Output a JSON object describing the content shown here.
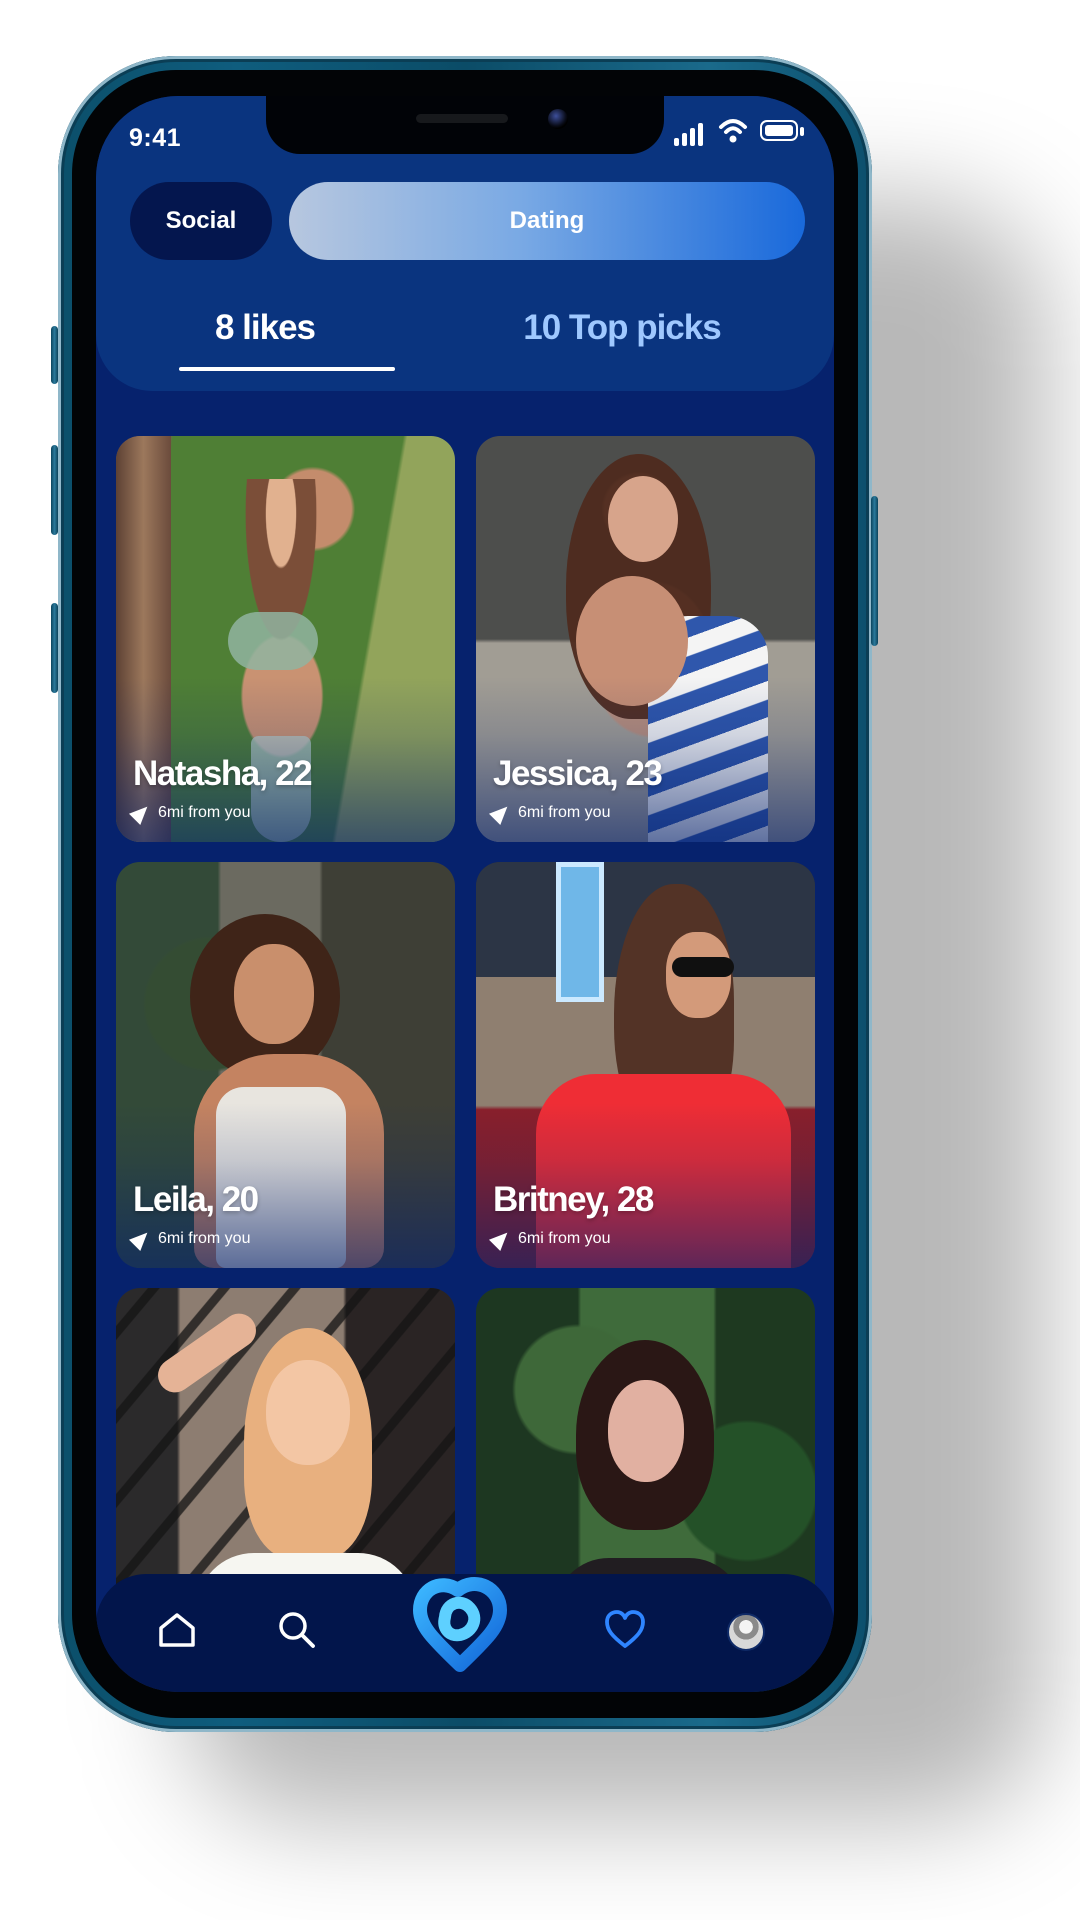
{
  "status_bar": {
    "time": "9:41",
    "icons": [
      "signal-icon",
      "wifi-icon",
      "battery-icon"
    ]
  },
  "mode_tabs": [
    {
      "label": "Social",
      "selected": false
    },
    {
      "label": "Dating",
      "selected": true
    }
  ],
  "subtabs": {
    "likes": "8 likes",
    "top_picks": "10 Top picks",
    "selected": "8 likes"
  },
  "profiles": [
    {
      "name": "Natasha, 22",
      "distance": "6mi from you"
    },
    {
      "name": "Jessica, 23",
      "distance": "6mi from you"
    },
    {
      "name": "Leila, 20",
      "distance": "6mi from you"
    },
    {
      "name": "Britney, 28",
      "distance": "6mi from you"
    },
    {
      "name": "",
      "distance": ""
    },
    {
      "name": "",
      "distance": ""
    }
  ],
  "navigation": {
    "items": [
      "home-icon",
      "search-icon",
      "app-logo-icon",
      "heart-icon",
      "profile-avatar"
    ],
    "active": "heart-icon"
  },
  "colors": {
    "screen_background": "#06226D",
    "header_background": "#0A347F",
    "dating_accent": "#1969DB",
    "top_picks_text": "#9FC8FF",
    "nav_background": "#02154B",
    "active_icon": "#2F85FF"
  }
}
